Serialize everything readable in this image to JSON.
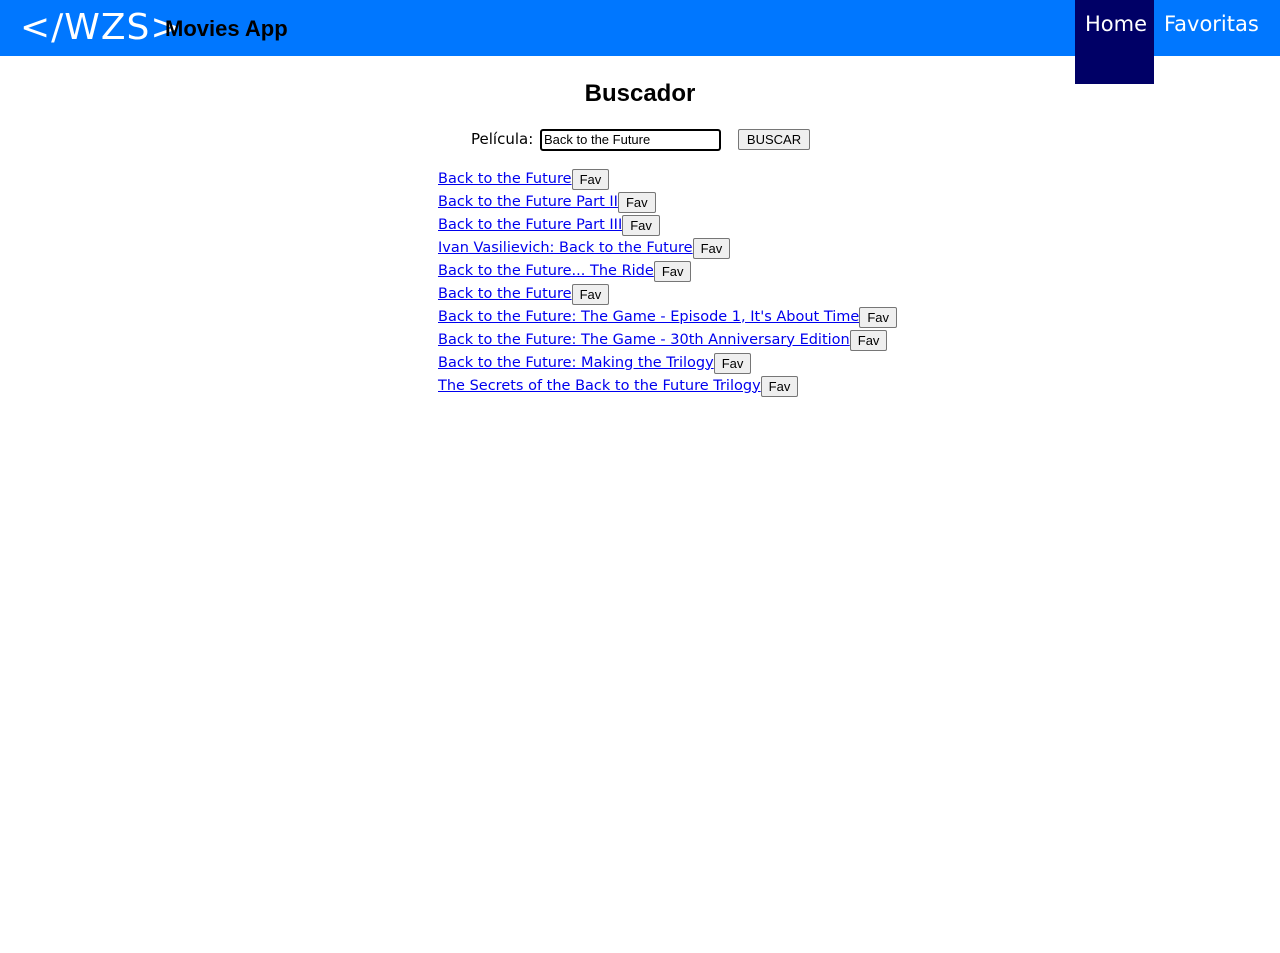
{
  "header": {
    "logo_text": "</WZS>",
    "app_title": "Movies App",
    "nav": {
      "home": "Home",
      "favorites": "Favoritas",
      "active": "Home"
    },
    "colors": {
      "bar": "#0077ff",
      "active_nav": "#000066"
    }
  },
  "search": {
    "heading": "Buscador",
    "label": "Película:",
    "value": "Back to the Future",
    "button_label": "BUSCAR"
  },
  "results": [
    {
      "title": "Back to the Future",
      "fav_label": "Fav"
    },
    {
      "title": "Back to the Future Part II",
      "fav_label": "Fav"
    },
    {
      "title": "Back to the Future Part III",
      "fav_label": "Fav"
    },
    {
      "title": "Ivan Vasilievich: Back to the Future",
      "fav_label": "Fav"
    },
    {
      "title": "Back to the Future... The Ride",
      "fav_label": "Fav"
    },
    {
      "title": "Back to the Future",
      "fav_label": "Fav"
    },
    {
      "title": "Back to the Future: The Game - Episode 1, It's About Time",
      "fav_label": "Fav"
    },
    {
      "title": "Back to the Future: The Game - 30th Anniversary Edition",
      "fav_label": "Fav"
    },
    {
      "title": "Back to the Future: Making the Trilogy",
      "fav_label": "Fav"
    },
    {
      "title": "The Secrets of the Back to the Future Trilogy",
      "fav_label": "Fav"
    }
  ]
}
